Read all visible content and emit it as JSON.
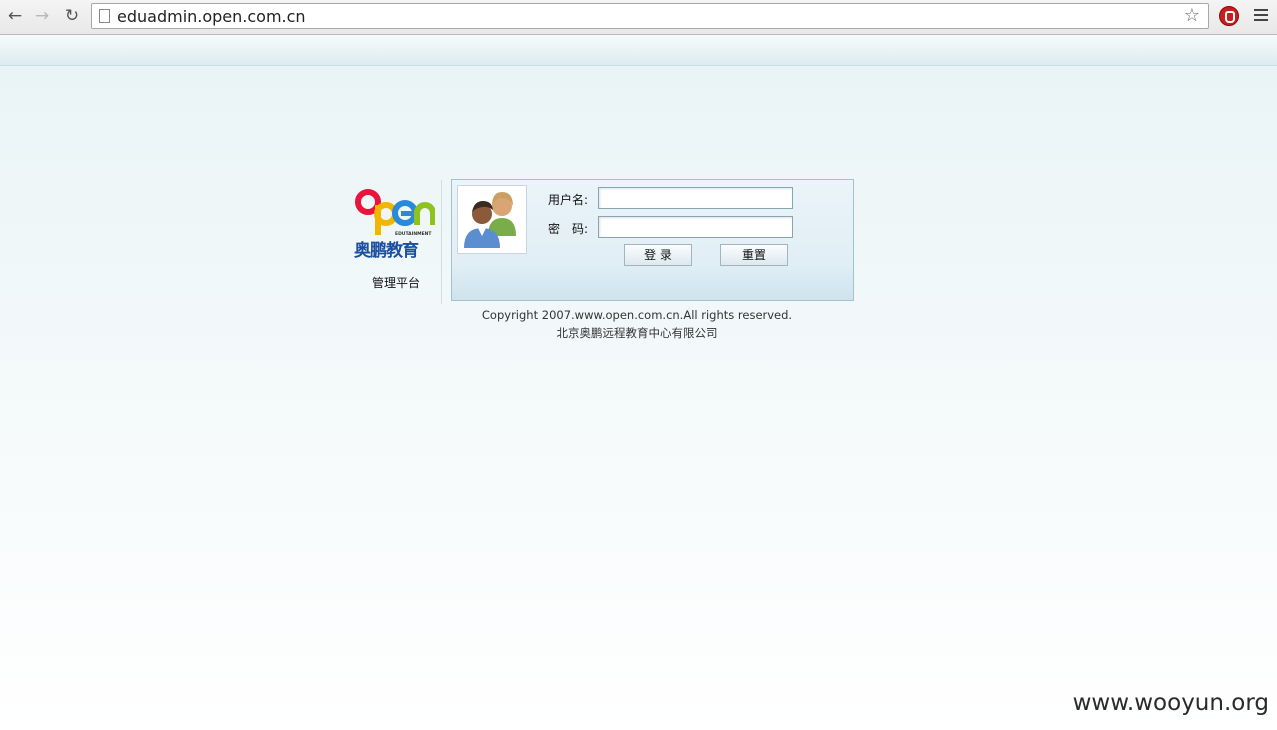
{
  "browser": {
    "url": "eduadmin.open.com.cn",
    "back_icon": "arrow-left-icon",
    "forward_icon": "arrow-right-icon",
    "reload_icon": "reload-icon"
  },
  "logo": {
    "brand_text": "open",
    "brand_sub": "EDUTAINMENT",
    "name_cn": "奥鹏教育",
    "platform": "管理平台",
    "colors": {
      "o": "#e8143c",
      "p": "#f2b500",
      "e": "#2b8ad8",
      "n": "#8dc21f"
    }
  },
  "login": {
    "username_label": "用户名:",
    "password_label": "密　码:",
    "username_value": "",
    "password_value": "",
    "login_button": "登 录",
    "reset_button": "重置"
  },
  "footer": {
    "copyright": "Copyright 2007.www.open.com.cn.All rights reserved.",
    "company": "北京奥鹏远程教育中心有限公司"
  },
  "watermark": "www.wooyun.org"
}
